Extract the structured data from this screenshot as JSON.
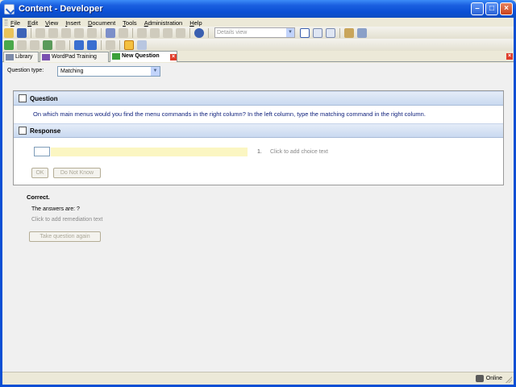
{
  "window": {
    "title": "Content - Developer"
  },
  "menu": [
    "File",
    "Edit",
    "View",
    "Insert",
    "Document",
    "Tools",
    "Administration",
    "Help"
  ],
  "toolbar": {
    "view_select": "Details view"
  },
  "tabs": [
    {
      "label": "Library"
    },
    {
      "label": "WordPad Training"
    },
    {
      "label": "New Question"
    }
  ],
  "question_type": {
    "label": "Question type:",
    "value": "Matching"
  },
  "question": {
    "header": "Question",
    "text": "On which main menus would you find the menu commands in the right column? In the left column, type the matching command in the right column."
  },
  "response": {
    "header": "Response",
    "choice_number": "1.",
    "choice_placeholder": "Click to add choice text",
    "ok_label": "OK",
    "do_not_know_label": "Do Not Know"
  },
  "feedback": {
    "title": "Correct.",
    "answers": "The answers are: ?",
    "remediation": "Click to add remediation text",
    "retry_label": "Take question again"
  },
  "status": {
    "text": "Online"
  },
  "colors": {
    "title_bar": "#0a4fd4",
    "question_text": "#0b1d7a",
    "choice_bar": "#fbf6c2",
    "section_header": "#c9d9f0"
  }
}
